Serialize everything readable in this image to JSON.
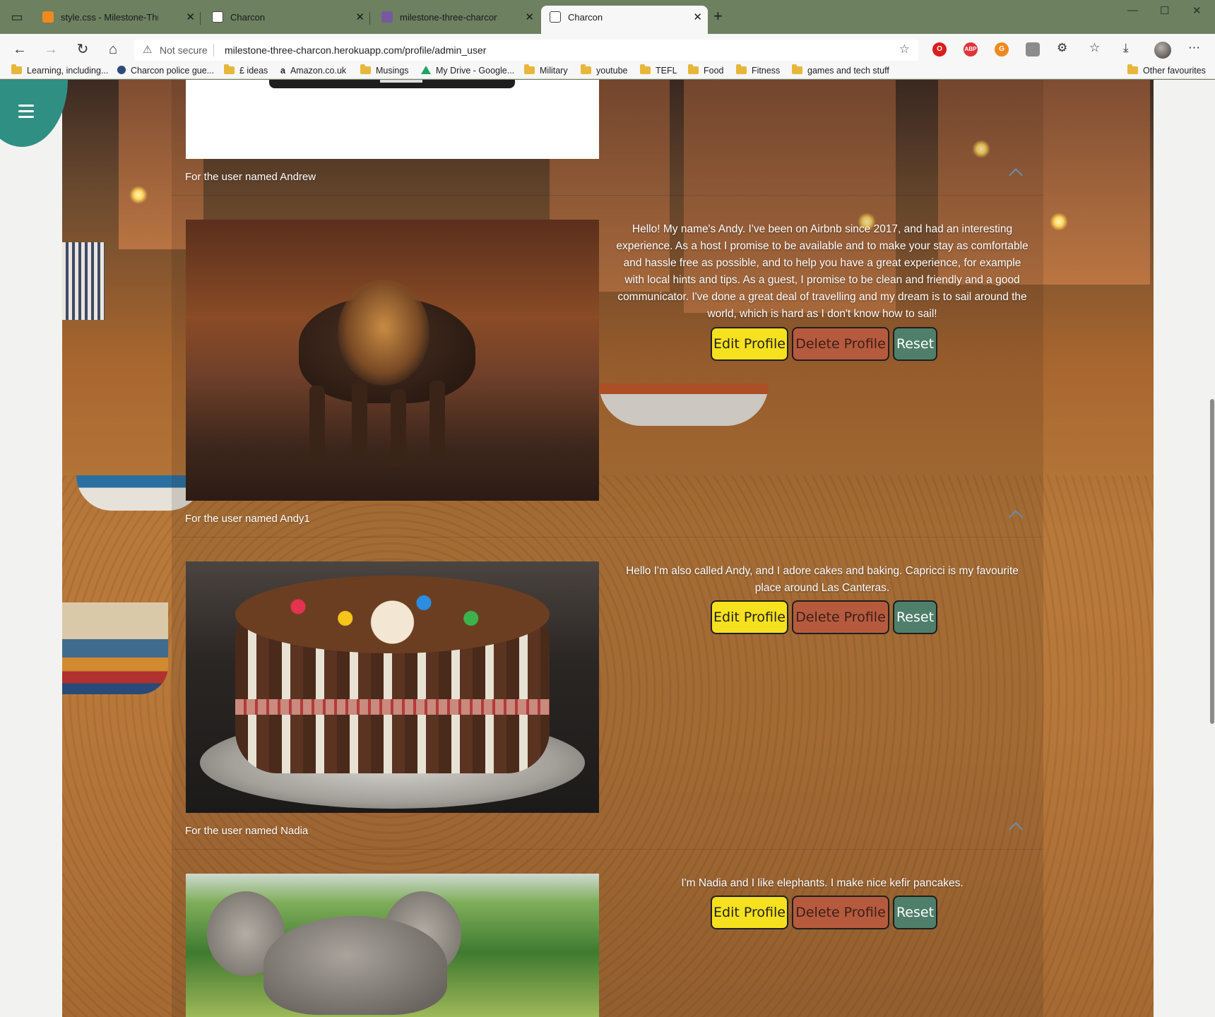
{
  "browser": {
    "tabs": [
      {
        "title": "style.css - Milestone-Three - Gitp",
        "favicon": "gitpod-icon",
        "color": "#f08a1e"
      },
      {
        "title": "Charcon",
        "favicon": "page-icon",
        "color": "#ffffff"
      },
      {
        "title": "milestone-three-charcon · Activit",
        "favicon": "heroku-icon",
        "color": "#79589f"
      },
      {
        "title": "Charcon",
        "favicon": "page-icon",
        "color": "#ffffff",
        "active": true
      }
    ],
    "security_label": "Not secure",
    "url": "milestone-three-charcon.herokuapp.com/profile/admin_user",
    "bookmarks": [
      {
        "label": "Learning, including...",
        "icon": "folder-icon"
      },
      {
        "label": "Charcon police gue...",
        "icon": "globe-icon"
      },
      {
        "label": "£ ideas",
        "icon": "folder-icon"
      },
      {
        "label": "Amazon.co.uk",
        "icon": "amazon-icon"
      },
      {
        "label": "Musings",
        "icon": "folder-icon"
      },
      {
        "label": "My Drive - Google...",
        "icon": "drive-icon"
      },
      {
        "label": "Military",
        "icon": "folder-icon"
      },
      {
        "label": "youtube",
        "icon": "folder-icon"
      },
      {
        "label": "TEFL",
        "icon": "folder-icon"
      },
      {
        "label": "Food",
        "icon": "folder-icon"
      },
      {
        "label": "Fitness",
        "icon": "folder-icon"
      },
      {
        "label": "games and tech stuff",
        "icon": "folder-icon"
      }
    ],
    "other_favourites": "Other favourites"
  },
  "page": {
    "accent_color": "#2f8f83",
    "users": [
      {
        "header": "For the user named Andrew",
        "image": "lion-photo",
        "bio": "Hello! My name's Andy. I've been on Airbnb since 2017, and had an interesting experience. As a host I promise to be available and to make your stay as comfortable and hassle free as possible, and to help you have a great experience, for example with local hints and tips. As a guest, I promise to be clean and friendly and a good communicator. I've done a great deal of travelling and my dream is to sail around the world, which is hard as I don't know how to sail!"
      },
      {
        "header": "For the user named Andy1",
        "image": "cake-photo",
        "bio": "Hello I'm also called Andy, and I adore cakes and baking. Capricci is my favourite place around Las Canteras."
      },
      {
        "header": "For the user named Nadia",
        "image": "elephant-photo",
        "bio": "I'm Nadia and I like elephants. I make nice kefir pancakes."
      }
    ],
    "buttons": {
      "edit": "Edit Profile",
      "delete": "Delete Profile",
      "reset": "Reset"
    },
    "button_colors": {
      "edit": "#f6e11e",
      "delete": "#b65a3e",
      "reset": "#4f7f6b"
    }
  }
}
